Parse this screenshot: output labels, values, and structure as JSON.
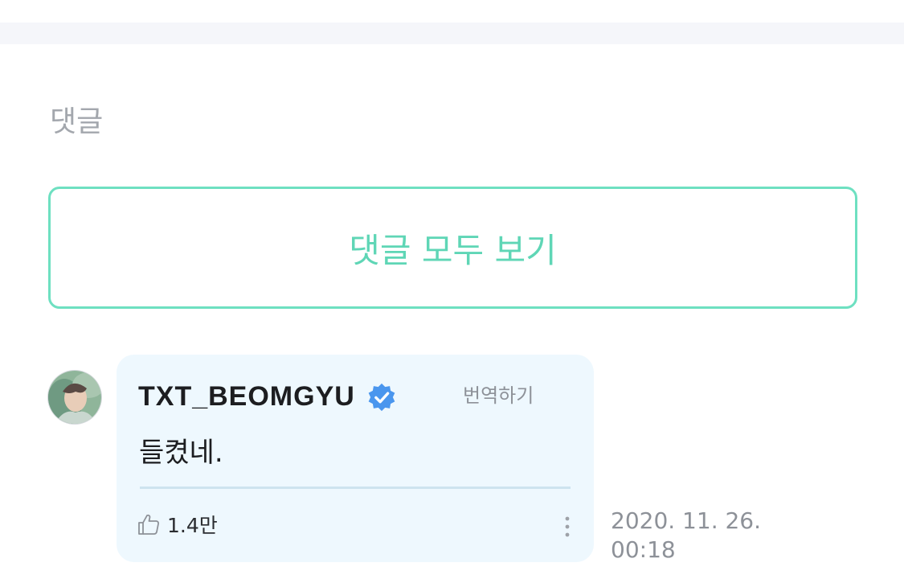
{
  "comments_section": {
    "title": "댓글",
    "view_all_label": "댓글 모두 보기"
  },
  "comment": {
    "author": "TXT_BEOMGYU",
    "verified_icon": "verified-badge-icon",
    "translate_label": "번역하기",
    "text": "들켰네.",
    "likes": "1.4만",
    "like_icon": "thumbs-up-icon",
    "more_icon": "more-vertical-icon",
    "date": "2020. 11. 26.",
    "time": "00:18"
  },
  "colors": {
    "accent": "#5fd6b6",
    "bubble": "#eef8fe",
    "verified": "#4a96ee"
  }
}
